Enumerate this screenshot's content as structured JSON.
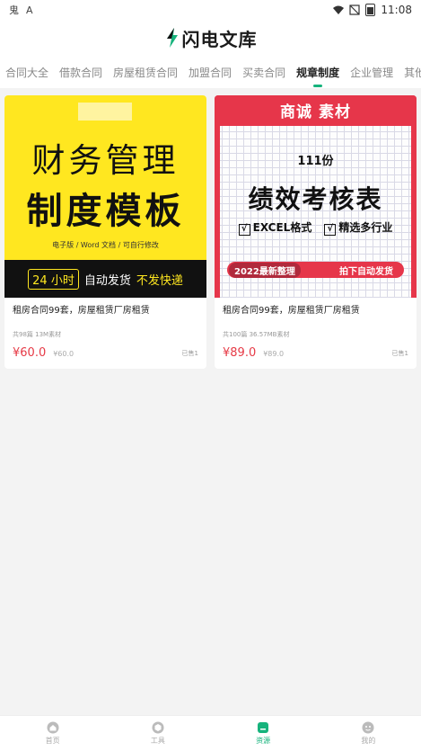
{
  "status_bar": {
    "left_icons": [
      "鬼",
      "A"
    ],
    "time": "11:08"
  },
  "header": {
    "title": "闪电文库"
  },
  "colors": {
    "accent": "#16b37c",
    "price": "#e63a46",
    "cover1_bg": "#ffe720",
    "cover2_red": "#e6364a"
  },
  "tabs": [
    {
      "label": "合同大全"
    },
    {
      "label": "借款合同"
    },
    {
      "label": "房屋租赁合同"
    },
    {
      "label": "加盟合同"
    },
    {
      "label": "买卖合同"
    },
    {
      "label": "规章制度",
      "active": true
    },
    {
      "label": "企业管理"
    },
    {
      "label": "其他模板"
    }
  ],
  "products": [
    {
      "cover": {
        "line1": "财务管理",
        "line2": "制度模板",
        "sub": "电子版 / Word 文档 / 可自行修改",
        "bottom_badge": "24 小时",
        "bottom_mid": "自动发货",
        "bottom_right": "不发快递"
      },
      "title": "租房合同99套，房屋租赁厂房租赁",
      "meta": "共98篇 13M素材",
      "price": "¥60.0",
      "orig_price": "¥60.0",
      "sold": "已售1"
    },
    {
      "cover": {
        "top_title": "商诚 素材",
        "count": "111份",
        "big": "绩效考核表",
        "feat1": "EXCEL格式",
        "feat2": "精选多行业",
        "bottom_left": "2022最新整理",
        "bottom_right": "拍下自动发货"
      },
      "title": "租房合同99套，房屋租赁厂房租赁",
      "meta": "共100篇 36.57MB素材",
      "price": "¥89.0",
      "orig_price": "¥89.0",
      "sold": "已售1"
    }
  ],
  "bottom_nav": [
    {
      "label": "首页",
      "icon": "home-icon"
    },
    {
      "label": "工具",
      "icon": "cube-icon"
    },
    {
      "label": "资源",
      "icon": "file-icon",
      "active": true
    },
    {
      "label": "我的",
      "icon": "profile-icon"
    }
  ]
}
